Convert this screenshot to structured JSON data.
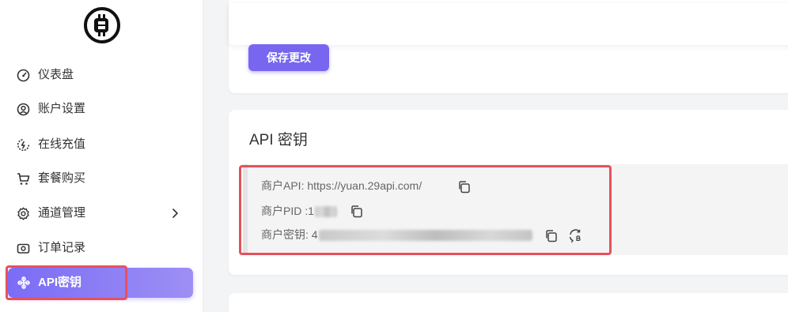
{
  "sidebar": {
    "items": [
      {
        "label": "仪表盘",
        "icon": "dashboard-icon"
      },
      {
        "label": "账户设置",
        "icon": "user-circle-icon"
      },
      {
        "label": "在线充值",
        "icon": "recharge-icon"
      },
      {
        "label": "套餐购买",
        "icon": "cart-icon"
      },
      {
        "label": "通道管理",
        "icon": "settings-icon"
      },
      {
        "label": "订单记录",
        "icon": "orders-icon"
      },
      {
        "label": "API密钥",
        "icon": "key-icon"
      }
    ]
  },
  "main": {
    "save_button": "保存更改",
    "api_section": {
      "title": "API 密钥",
      "merchant_api_label": "商户API: ",
      "merchant_api_value": "https://yuan.29api.com/",
      "merchant_pid_label": "商户PID :",
      "merchant_pid_value": "1",
      "merchant_key_label": "商户密钥: ",
      "merchant_key_value": "4"
    }
  },
  "colors": {
    "accent": "#7866f0",
    "highlight": "#e8505b"
  }
}
